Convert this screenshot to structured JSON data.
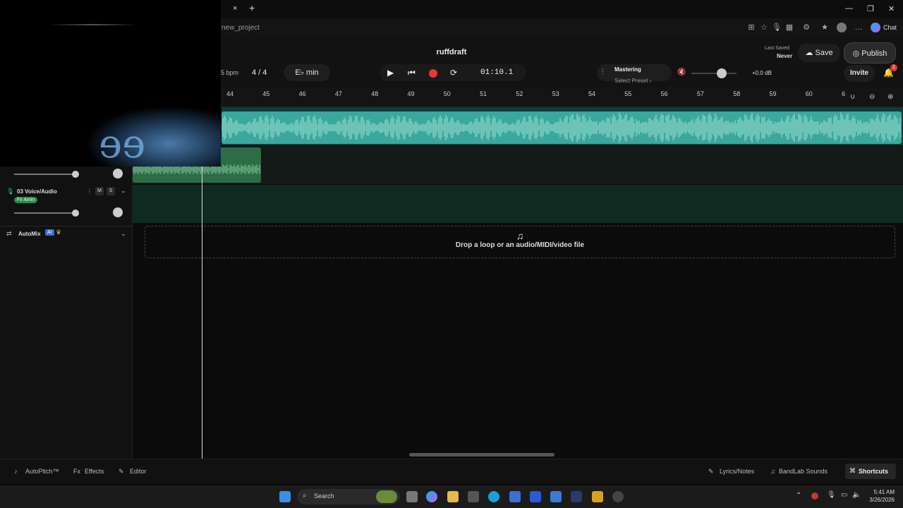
{
  "browser": {
    "url": "new_project",
    "chat_label": "Chat",
    "tab_close": "×",
    "tab_new": "+"
  },
  "header": {
    "title": "ruffdraft",
    "bpm_value": "5",
    "bpm_unit": "bpm",
    "time_signature": "4 / 4",
    "key": "E♭ min",
    "time_display": "01:10.1",
    "mastering_label": "Mastering",
    "mastering_sub": "Select Preset ›",
    "volume_db": "+0.0 dB",
    "volume_level": 0.6,
    "last_saved_label": "Last Saved",
    "last_saved_value": "Never",
    "save_label": "Save",
    "publish_label": "Publish",
    "invite_label": "Invite",
    "notification_count": "1"
  },
  "ruler": {
    "ticks": [
      "44",
      "45",
      "46",
      "47",
      "48",
      "49",
      "50",
      "51",
      "52",
      "53",
      "54",
      "55",
      "56",
      "57",
      "58",
      "59",
      "60",
      "6"
    ]
  },
  "tracks": [
    {
      "name": "03 Voice/Audio",
      "fx": "Fx Amin",
      "mute": "M",
      "solo": "S"
    }
  ],
  "automix": {
    "label": "AutoMix",
    "badge": "AI"
  },
  "dropzone": {
    "text": "Drop a loop or an audio/MIDI/video file"
  },
  "bottombar": {
    "autopitch": "AutoPitch™",
    "effects": "Effects",
    "editor": "Editor",
    "lyrics": "Lyrics/Notes",
    "sounds": "BandLab Sounds",
    "shortcuts": "Shortcuts"
  },
  "taskbar": {
    "search_placeholder": "Search",
    "time": "5:41 AM",
    "date": "3/26/2026"
  },
  "colors": {
    "accent_teal": "#3aa89c",
    "accent_green": "#2d6c44",
    "record_red": "#e53935"
  }
}
